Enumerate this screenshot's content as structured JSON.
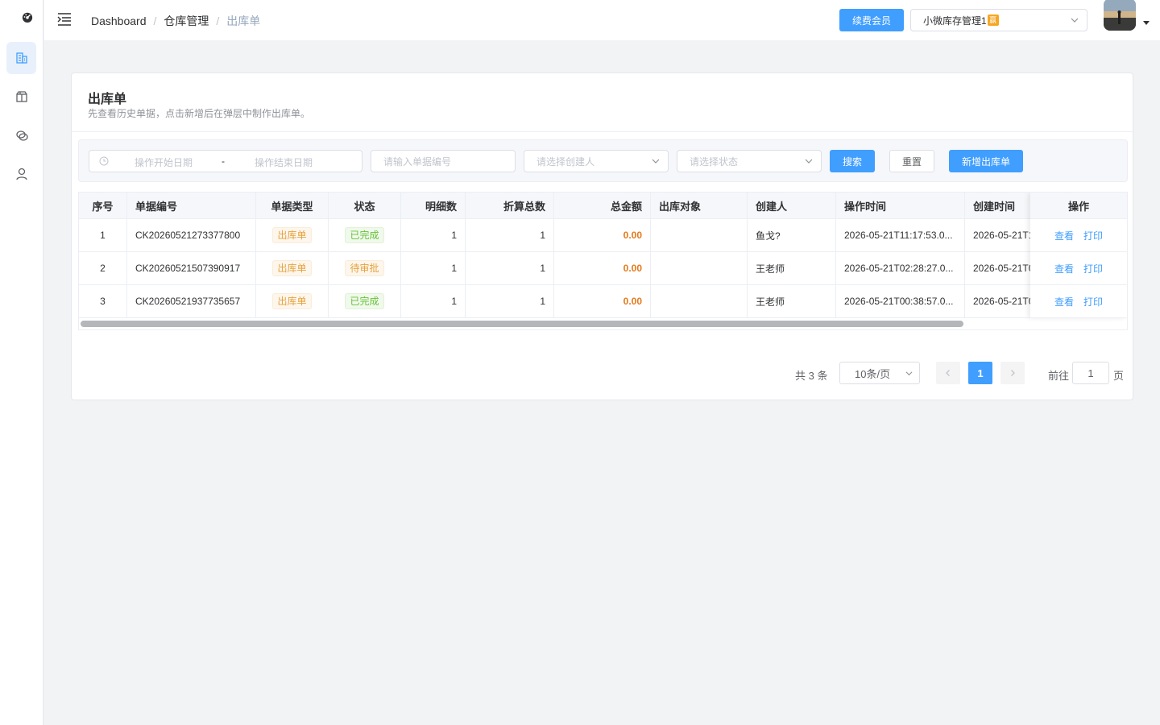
{
  "breadcrumb": [
    "Dashboard",
    "仓库管理",
    "出库单"
  ],
  "header": {
    "renew_label": "续费会员",
    "store_name": "小微库存管理1",
    "store_badge": "赢"
  },
  "sidebar": {
    "items": [
      {
        "icon": "building-icon",
        "active": true
      },
      {
        "icon": "package-icon",
        "active": false
      },
      {
        "icon": "chat-icon",
        "active": false
      },
      {
        "icon": "user-icon",
        "active": false
      }
    ]
  },
  "card": {
    "title": "出库单",
    "subtitle": "先查看历史单据，点击新增后在弹层中制作出库单。"
  },
  "filter": {
    "start_placeholder": "操作开始日期",
    "range_separator": "-",
    "end_placeholder": "操作结束日期",
    "order_no_placeholder": "请输入单据编号",
    "creator_placeholder": "请选择创建人",
    "status_placeholder": "请选择状态",
    "search_label": "搜索",
    "reset_label": "重置",
    "add_label": "新增出库单"
  },
  "table": {
    "columns": [
      "序号",
      "单据编号",
      "单据类型",
      "状态",
      "明细数",
      "折算总数",
      "总金额",
      "出库对象",
      "创建人",
      "操作时间",
      "创建时间",
      "操作"
    ],
    "rows": [
      {
        "index": "1",
        "order_no": "CK20260521273377800",
        "type": "出库单",
        "status": "已完成",
        "status_kind": "ok",
        "detail_count": "1",
        "total_qty": "1",
        "amount": "0.00",
        "target": "",
        "creator": "鱼戈?",
        "op_time": "2026-05-21T11:17:53.0...",
        "created": "2026-05-21T1"
      },
      {
        "index": "2",
        "order_no": "CK20260521507390917",
        "type": "出库单",
        "status": "待审批",
        "status_kind": "warn",
        "detail_count": "1",
        "total_qty": "1",
        "amount": "0.00",
        "target": "",
        "creator": "王老师",
        "op_time": "2026-05-21T02:28:27.0...",
        "created": "2026-05-21T0"
      },
      {
        "index": "3",
        "order_no": "CK20260521937735657",
        "type": "出库单",
        "status": "已完成",
        "status_kind": "ok",
        "detail_count": "1",
        "total_qty": "1",
        "amount": "0.00",
        "target": "",
        "creator": "王老师",
        "op_time": "2026-05-21T00:38:57.0...",
        "created": "2026-05-21T0"
      }
    ],
    "actions": [
      "查看",
      "打印"
    ]
  },
  "pagination": {
    "total_text": "共 3 条",
    "page_size": "10条/页",
    "current_page": "1",
    "goto_label": "前往",
    "goto_value": "1",
    "page_suffix": "页"
  },
  "colors": {
    "primary": "#409eff",
    "warning": "#e6a23c",
    "success": "#67c23a",
    "amount": "#e6791a"
  }
}
